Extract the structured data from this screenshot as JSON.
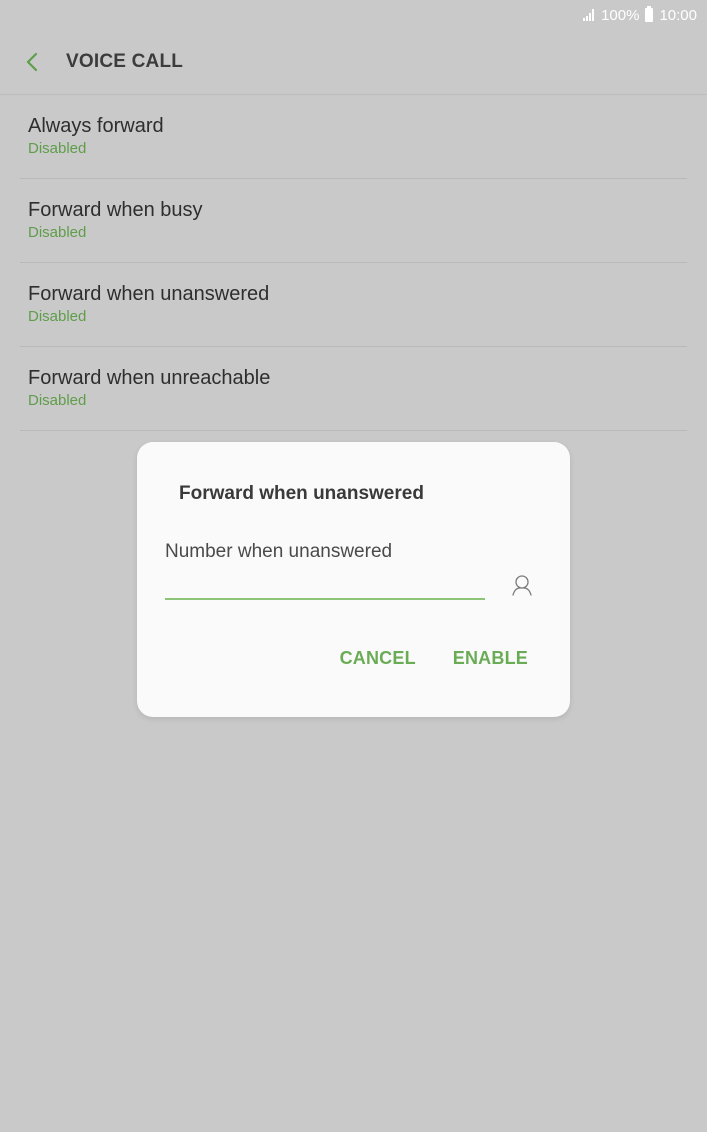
{
  "status_bar": {
    "battery": "100%",
    "time": "10:00",
    "icons": [
      "signal-icon",
      "battery-icon"
    ]
  },
  "app_bar": {
    "title": "VOICE CALL",
    "back_icon": "back-arrow-icon",
    "accent_color": "#5f9d4a"
  },
  "settings": [
    {
      "title": "Always forward",
      "status": "Disabled"
    },
    {
      "title": "Forward when busy",
      "status": "Disabled"
    },
    {
      "title": "Forward when unanswered",
      "status": "Disabled"
    },
    {
      "title": "Forward when unreachable",
      "status": "Disabled"
    }
  ],
  "dialog": {
    "title": "Forward when unanswered",
    "field_label": "Number when unanswered",
    "input_value": "",
    "contact_icon": "contact-person-icon",
    "cancel_label": "CANCEL",
    "enable_label": "ENABLE"
  }
}
